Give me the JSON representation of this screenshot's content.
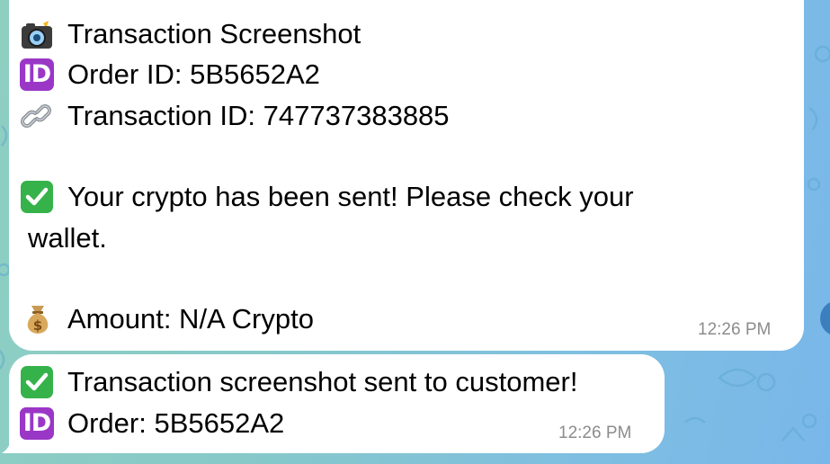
{
  "message_1": {
    "title": "Transaction Screenshot",
    "order_id": "Order ID: 5B5652A2",
    "transaction_id": "Transaction ID: 747737383885",
    "status_line_1": "Your crypto has been sent! Please check your",
    "status_line_2": "wallet.",
    "amount": "Amount: N/A Crypto",
    "time": "12:26 PM",
    "icons": [
      "camera-with-flash-icon",
      "id-icon",
      "link-icon",
      "check-mark-icon",
      "money-bag-icon"
    ]
  },
  "message_2": {
    "confirmation": "Transaction screenshot sent to customer!",
    "order": "Order: 5B5652A2",
    "time": "12:26 PM",
    "icons": [
      "check-mark-icon",
      "id-icon"
    ]
  },
  "colors": {
    "bubble": "#ffffff",
    "check": "#36b24a",
    "id_badge": "#9a37c7",
    "timestamp": "#8c8c8c",
    "background": "#7fbfe0"
  }
}
